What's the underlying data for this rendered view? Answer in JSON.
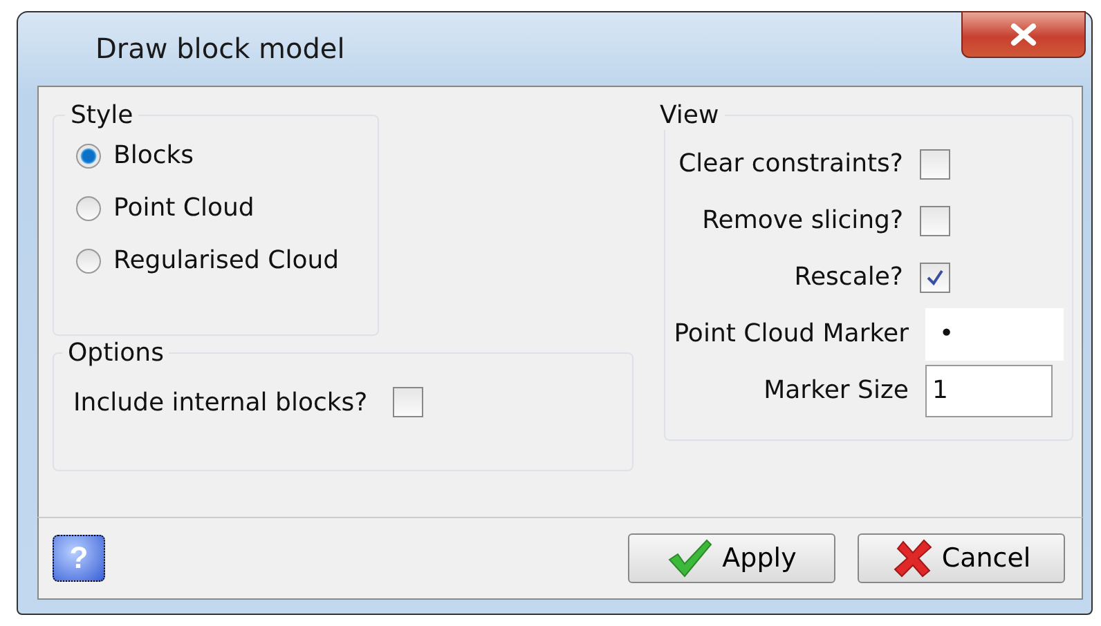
{
  "window": {
    "title": "Draw block model"
  },
  "style": {
    "title": "Style",
    "options": [
      {
        "label": "Blocks",
        "selected": true
      },
      {
        "label": "Point Cloud",
        "selected": false
      },
      {
        "label": "Regularised Cloud",
        "selected": false
      }
    ]
  },
  "options": {
    "title": "Options",
    "items": [
      {
        "label": "Include internal blocks?",
        "checked": false
      }
    ]
  },
  "view": {
    "title": "View",
    "items": [
      {
        "kind": "checkbox",
        "label": "Clear constraints?",
        "checked": false
      },
      {
        "kind": "checkbox",
        "label": "Remove slicing?",
        "checked": false
      },
      {
        "kind": "checkbox",
        "label": "Rescale?",
        "checked": true
      },
      {
        "kind": "marker",
        "label": "Point Cloud Marker",
        "value": "•"
      },
      {
        "kind": "input",
        "label": "Marker Size",
        "value": "1"
      }
    ]
  },
  "help_button": {
    "label": "?"
  },
  "buttons": [
    {
      "kind": "apply",
      "label": "Apply"
    },
    {
      "kind": "cancel",
      "label": "Cancel"
    }
  ]
}
